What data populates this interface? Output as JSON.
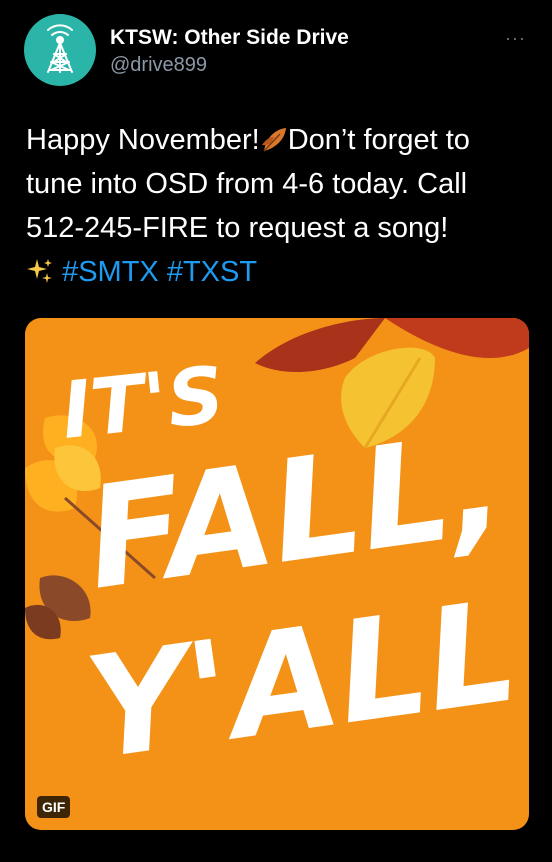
{
  "tweet": {
    "author_name": "KTSW: Other Side Drive",
    "author_handle": "@drive899",
    "more": "···",
    "text_part1": "Happy November!",
    "text_part2": "Don’t forget to tune into OSD from 4-6 today. Call 512-245-FIRE to request a song!",
    "hashtags": [
      "#SMTX",
      "#TXST"
    ],
    "icons": [
      "fallen-leaf-emoji",
      "sparkles-emoji"
    ]
  },
  "media": {
    "gif_badge": "GIF",
    "art_line1": "IT'S",
    "art_line2": "FALL,",
    "art_line3": "Y'ALL",
    "colors": {
      "background": "#f49218",
      "leaf_yellow": "#f5c332",
      "leaf_red": "#a8321a",
      "leaf_brown": "#8a4a2a"
    }
  },
  "colors": {
    "link": "#1d9bf0",
    "avatar": "#2bb5a8",
    "secondary_text": "#8b98a5"
  }
}
